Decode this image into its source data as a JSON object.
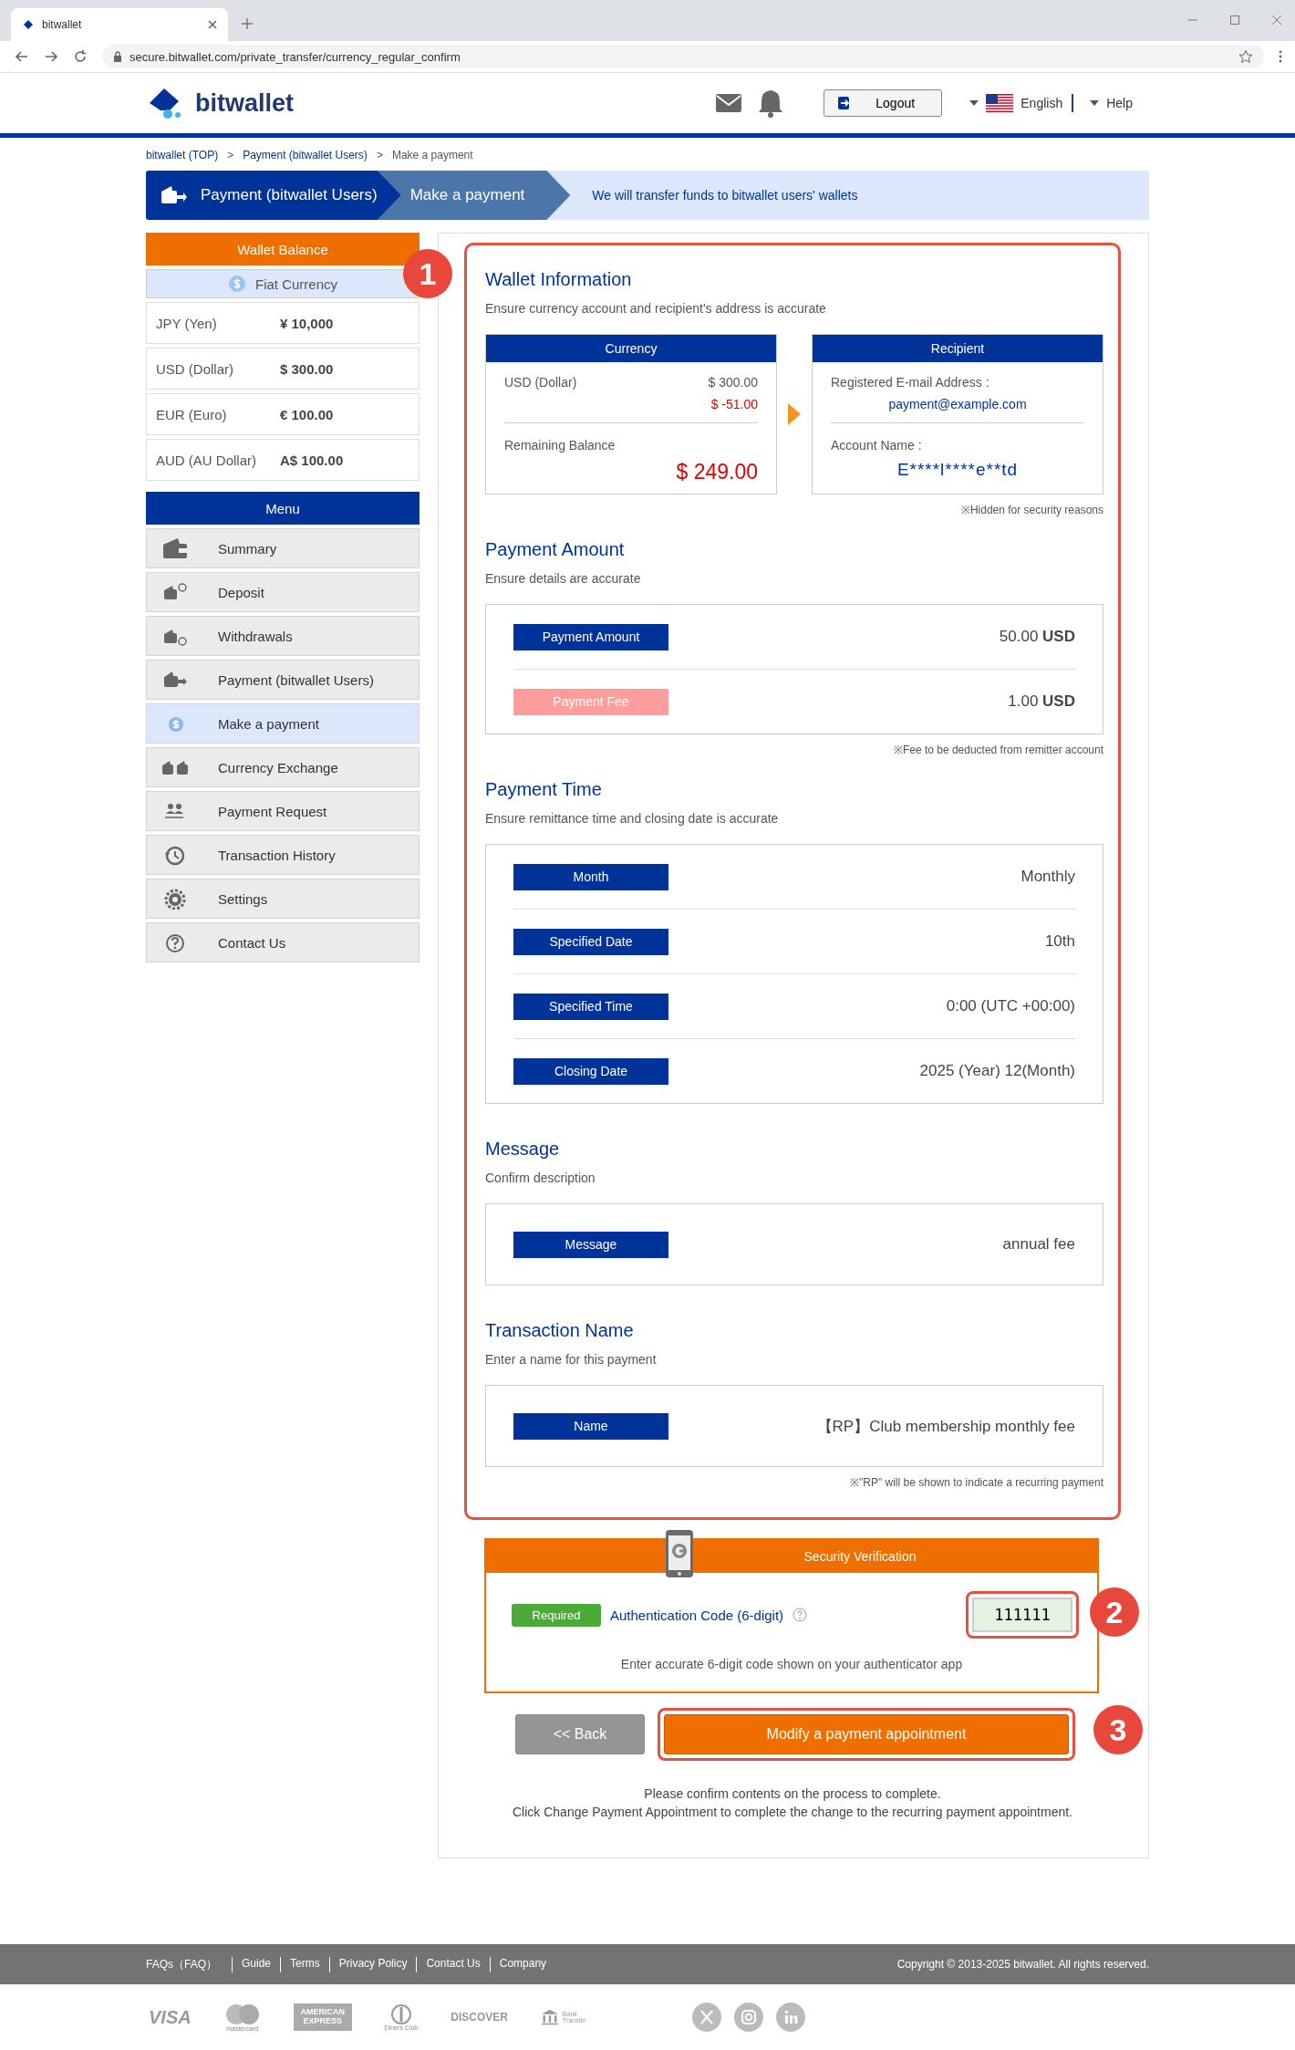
{
  "browser": {
    "tab_title": "bitwallet",
    "url": "secure.bitwallet.com/private_transfer/currency_regular_confirm"
  },
  "header": {
    "logo_text": "bitwallet",
    "logout": "Logout",
    "language": "English",
    "help": "Help"
  },
  "breadcrumb": [
    {
      "label": "bitwallet (TOP)",
      "link": true
    },
    {
      "separator": ">",
      "label": "Payment (bitwallet Users)",
      "link": true
    },
    {
      "separator": ">",
      "label": "Make a payment",
      "link": false
    }
  ],
  "banner": {
    "steps": [
      {
        "label": "Payment (bitwallet Users)",
        "selected": false
      },
      {
        "label": "Make a payment",
        "selected": true
      }
    ],
    "note": "We will transfer funds to bitwallet users' wallets"
  },
  "wallet_balance": {
    "title": "Wallet Balance",
    "category": "Fiat Currency",
    "rows": [
      {
        "currency": "JPY (Yen)",
        "amount": "¥ 10,000"
      },
      {
        "currency": "USD (Dollar)",
        "amount": "$ 300.00"
      },
      {
        "currency": "EUR (Euro)",
        "amount": "€ 100.00"
      },
      {
        "currency": "AUD (AU Dollar)",
        "amount": "A$ 100.00"
      }
    ]
  },
  "menu": {
    "title": "Menu",
    "items": [
      {
        "label": "Summary",
        "selected": false
      },
      {
        "label": "Deposit",
        "selected": false
      },
      {
        "label": "Withdrawals",
        "selected": false
      },
      {
        "label": "Payment (bitwallet Users)",
        "selected": false
      },
      {
        "label": "Make a payment",
        "selected": true
      },
      {
        "label": "Currency Exchange",
        "selected": false
      },
      {
        "label": "Payment Request",
        "selected": false
      },
      {
        "label": "Transaction History",
        "selected": false
      },
      {
        "label": "Settings",
        "selected": false
      },
      {
        "label": "Contact Us",
        "selected": false
      }
    ]
  },
  "wallet_info": {
    "title": "Wallet Information",
    "subtitle": "Ensure currency account and recipient's address is accurate",
    "currency_card": {
      "header": "Currency",
      "currency": "USD (Dollar)",
      "balance": "$ 300.00",
      "change": "$ -51.00",
      "remaining_label": "Remaining Balance",
      "remaining": "$ 249.00"
    },
    "recipient_card": {
      "header": "Recipient",
      "email_label": "Registered E-mail Address :",
      "email": "payment@example.com",
      "account_label": "Account Name :",
      "account": "E****l****e**td"
    },
    "note": "※Hidden for security reasons"
  },
  "payment_amount": {
    "title": "Payment Amount",
    "subtitle": "Ensure details are accurate",
    "rows": [
      {
        "kind": "amount",
        "label": "Payment Amount",
        "value": "50.00 **USD**"
      },
      {
        "kind": "fee",
        "label": "Payment Fee",
        "value": "1.00 **USD**"
      }
    ],
    "note": "※Fee to be deducted from remitter account"
  },
  "payment_time": {
    "title": "Payment Time",
    "subtitle": "Ensure remittance time and closing date is accurate",
    "rows": [
      {
        "kind": "amount",
        "label": "Month",
        "value": "Monthly"
      },
      {
        "kind": "amount",
        "label": "Specified Date",
        "value": "10th"
      },
      {
        "kind": "amount",
        "label": "Specified Time",
        "value": "0:00 (UTC +00:00)"
      },
      {
        "kind": "amount",
        "label": "Closing Date",
        "value": "2025 (Year) 12(Month)"
      }
    ]
  },
  "message": {
    "title": "Message",
    "subtitle": "Confirm description",
    "rows": [
      {
        "kind": "amount",
        "label": "Message",
        "value": "annual fee"
      }
    ]
  },
  "transaction_name": {
    "title": "Transaction Name",
    "subtitle": "Enter a name for this payment",
    "rows": [
      {
        "kind": "amount",
        "label": "Name",
        "value": "【RP】Club membership monthly fee"
      }
    ],
    "note": "※\"RP\" will be shown to indicate a recurring payment"
  },
  "security": {
    "title": "Security Verification",
    "required": "Required",
    "label": "Authentication Code (6-digit)",
    "code": "111111",
    "hint": "Enter accurate 6-digit code shown on your authenticator app"
  },
  "buttons": {
    "back": "<< Back",
    "submit": "Modify a payment appointment"
  },
  "notes": [
    "Please confirm contents on the process to complete.",
    "Click Change Payment Appointment to complete the change to the recurring payment appointment."
  ],
  "markers": [
    "1",
    "2",
    "3"
  ],
  "footer": {
    "links": [
      "FAQs（FAQ）",
      "Guide",
      "Terms",
      "Privacy Policy",
      "Contact Us",
      "Company"
    ],
    "copyright": "Copyright © 2013-2025 bitwallet. All rights reserved.",
    "payment_logos": [
      "VISA",
      "mastercard",
      "AMERICAN EXPRESS",
      "Diners Club",
      "DISCOVER",
      "Bank Transfer"
    ]
  }
}
